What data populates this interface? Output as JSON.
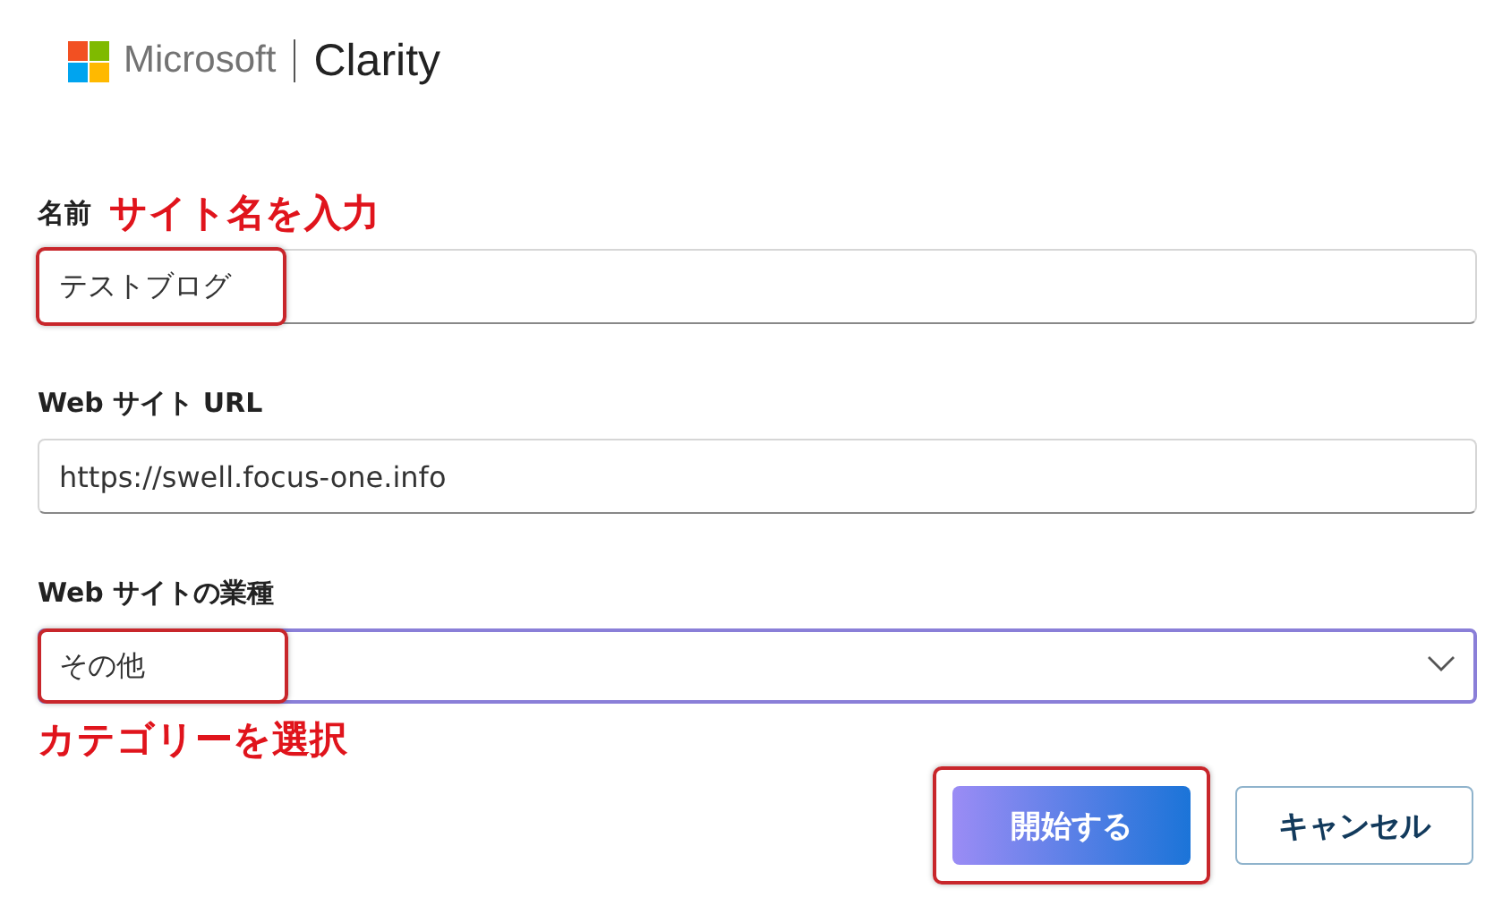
{
  "logo": {
    "company": "Microsoft",
    "product": "Clarity"
  },
  "fields": [
    {
      "kind": "text",
      "label": "名前",
      "annotation": "サイト名を入力",
      "value": "テストブログ",
      "highlighted": true,
      "focused": false
    },
    {
      "kind": "text",
      "label": "Web サイト URL",
      "value": "https://swell.focus-one.info",
      "highlighted": false,
      "focused": false
    },
    {
      "kind": "select",
      "label": "Web サイトの業種",
      "value": "その他",
      "highlighted": true,
      "focused": true,
      "note": "カテゴリーを選択"
    }
  ],
  "buttons": [
    {
      "kind": "primary",
      "label": "開始する",
      "highlighted": true
    },
    {
      "kind": "secondary",
      "label": "キャンセル",
      "highlighted": false
    }
  ]
}
